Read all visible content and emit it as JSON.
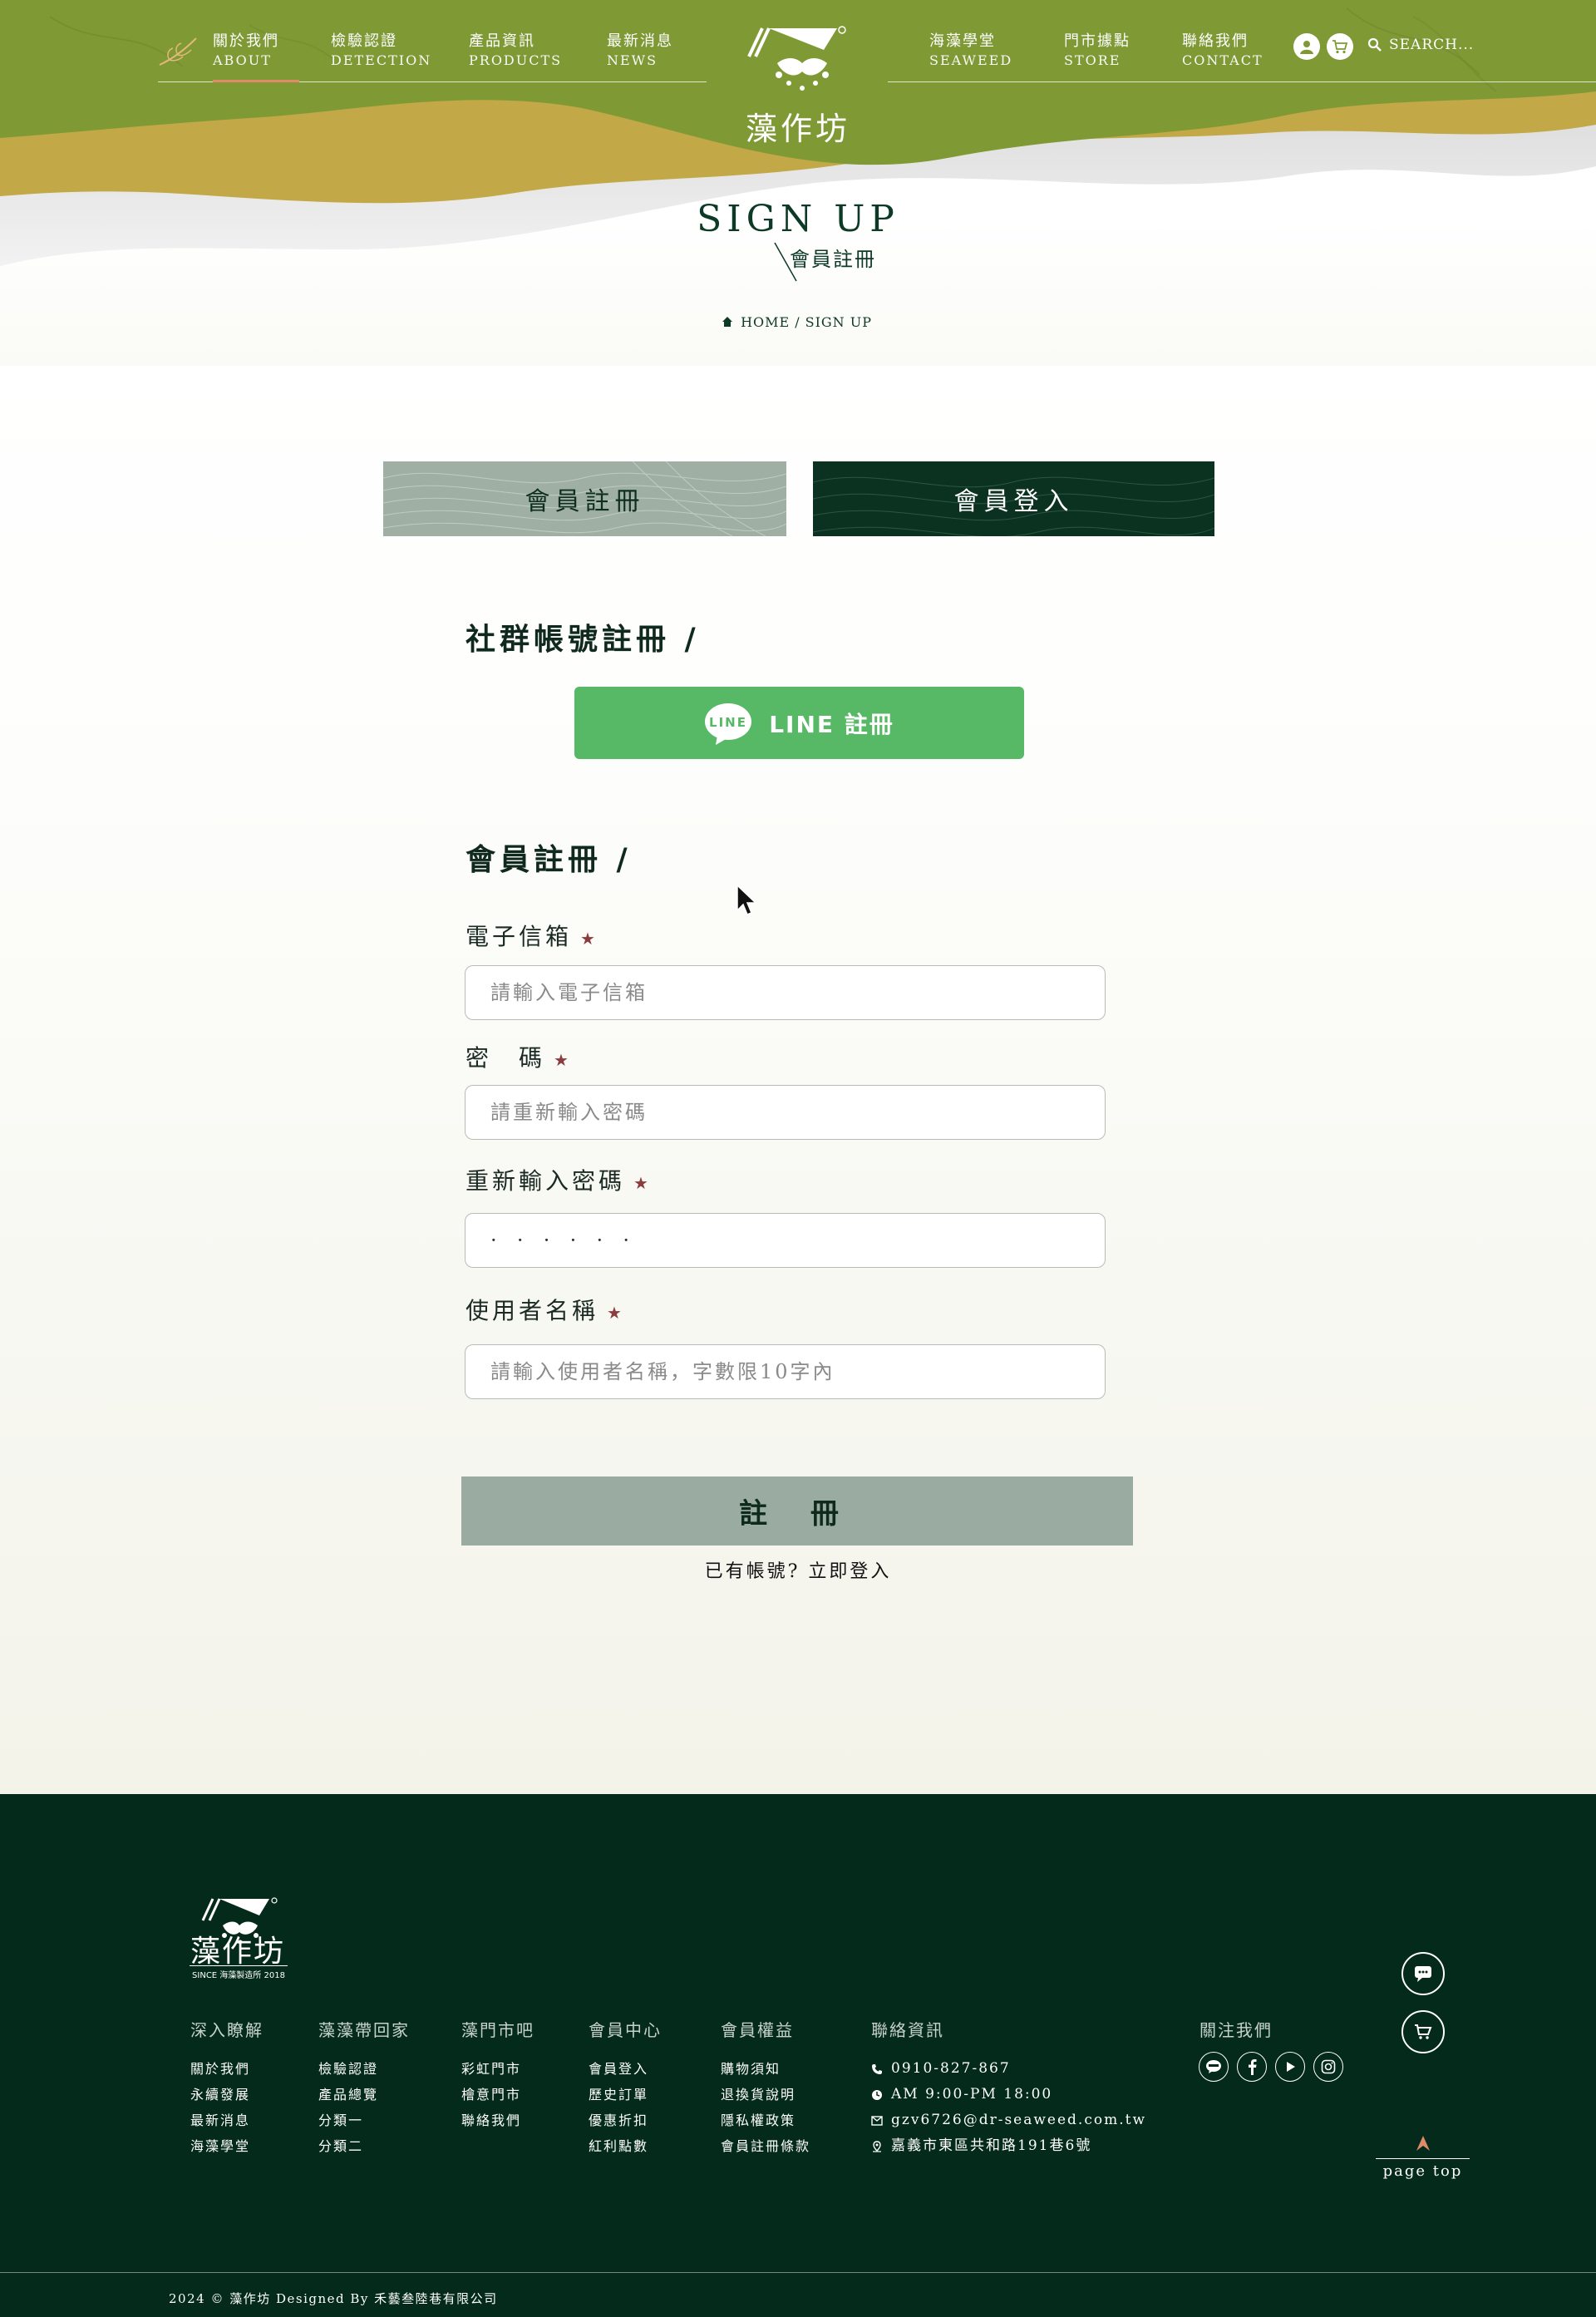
{
  "header": {
    "nav_left": [
      {
        "zh": "關於我們",
        "en": "ABOUT"
      },
      {
        "zh": "檢驗認證",
        "en": "DETECTION"
      },
      {
        "zh": "產品資訊",
        "en": "PRODUCTS"
      },
      {
        "zh": "最新消息",
        "en": "NEWS"
      }
    ],
    "nav_right": [
      {
        "zh": "海藻學堂",
        "en": "SEAWEED"
      },
      {
        "zh": "門市據點",
        "en": "STORE"
      },
      {
        "zh": "聯絡我們",
        "en": "CONTACT"
      }
    ],
    "logo_text": "藻作坊",
    "search_placeholder": "SEARCH..."
  },
  "hero": {
    "title": "SIGN UP",
    "subtitle": "會員註冊",
    "breadcrumb_home": "HOME",
    "breadcrumb_sep": "/",
    "breadcrumb_current": "SIGN UP"
  },
  "tabs": {
    "register": "會員註冊",
    "login": "會員登入"
  },
  "social_section": {
    "title": "社群帳號註冊 /",
    "line_badge": "LINE",
    "line_button": "LINE 註冊"
  },
  "form": {
    "title": "會員註冊 /",
    "star": "★",
    "email_label": "電子信箱",
    "email_placeholder": "請輸入電子信箱",
    "password_label": "密　碼",
    "password_placeholder": "請重新輸入密碼",
    "confirm_label": "重新輸入密碼",
    "confirm_value": "·  ·  ·  ·  ·  ·",
    "username_label": "使用者名稱",
    "username_placeholder": "請輸入使用者名稱，字數限10字內",
    "submit": "註 冊",
    "have_account": "已有帳號?",
    "login_link": "立即登入"
  },
  "footer": {
    "logo_text": "藻作坊",
    "logo_since": "SINCE 海藻製造所 2018",
    "columns": [
      {
        "title": "深入瞭解",
        "items": [
          "關於我們",
          "永續發展",
          "最新消息",
          "海藻學堂"
        ]
      },
      {
        "title": "藻藻帶回家",
        "items": [
          "檢驗認證",
          "產品總覽",
          "分類一",
          "分類二"
        ]
      },
      {
        "title": "藻門市吧",
        "items": [
          "彩虹門市",
          "檜意門市",
          "聯絡我們"
        ]
      },
      {
        "title": "會員中心",
        "items": [
          "會員登入",
          "歷史訂單",
          "優惠折扣",
          "紅利點數"
        ]
      },
      {
        "title": "會員權益",
        "items": [
          "購物須知",
          "退換貨說明",
          "隱私權政策",
          "會員註冊條款"
        ]
      }
    ],
    "contact": {
      "title": "聯絡資訊",
      "phone": "0910-827-867",
      "hours": "AM 9:00-PM 18:00",
      "email": "gzv6726@dr-seaweed.com.tw",
      "address": "嘉義市東區共和路191巷6號"
    },
    "follow_title": "關注我們",
    "social_icons": [
      "line-icon",
      "facebook-icon",
      "youtube-icon",
      "instagram-icon"
    ],
    "page_top": "page top",
    "copyright": "2024 © 藻作坊 Designed By 禾藝叁陸巷有限公司"
  },
  "colors": {
    "dark_green": "#032a1a",
    "olive": "#7f9a35",
    "mustard": "#c2a846",
    "line_green": "#57b866",
    "tab_sage": "#9fafa3",
    "accent": "#e08a6a"
  }
}
